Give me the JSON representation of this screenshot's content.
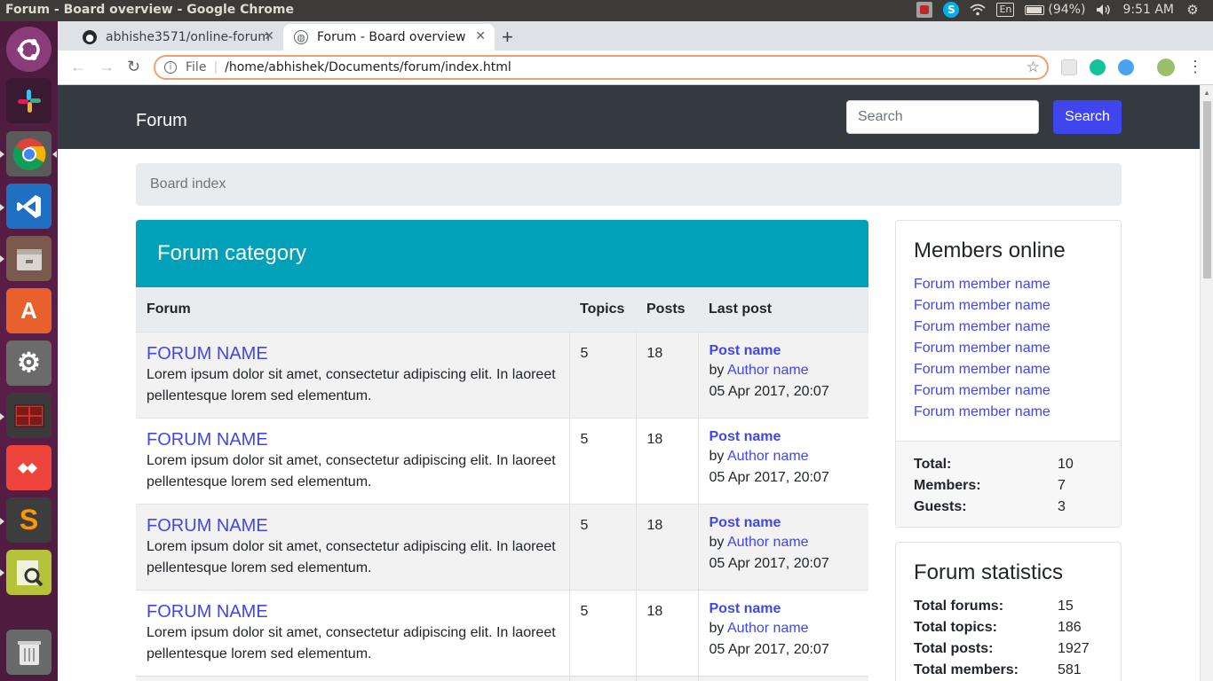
{
  "os": {
    "window_title": "Forum - Board overview - Google Chrome",
    "battery": "(94%)",
    "keyboard_layout": "En",
    "clock": "9:51 AM"
  },
  "browser": {
    "tabs": [
      {
        "title": "abhishe3571/online-forum",
        "icon": "github-icon"
      },
      {
        "title": "Forum - Board overview",
        "icon": "globe-icon"
      }
    ],
    "address_scheme": "File",
    "address": "/home/abhishek/Documents/forum/index.html"
  },
  "page": {
    "brand": "Forum",
    "search": {
      "placeholder": "Search",
      "button": "Search"
    },
    "breadcrumb": "Board index",
    "category": {
      "title": "Forum category",
      "headers": [
        "Forum",
        "Topics",
        "Posts",
        "Last post"
      ],
      "rows": [
        {
          "name": "FORUM NAME",
          "desc": "Lorem ipsum dolor sit amet, consectetur adipiscing elit. In laoreet pellentesque lorem sed elementum.",
          "topics": "5",
          "posts": "18",
          "last_post": "Post name",
          "by": "by ",
          "author": "Author name",
          "date": "05 Apr 2017, 20:07"
        },
        {
          "name": "FORUM NAME",
          "desc": "Lorem ipsum dolor sit amet, consectetur adipiscing elit. In laoreet pellentesque lorem sed elementum.",
          "topics": "5",
          "posts": "18",
          "last_post": "Post name",
          "by": "by ",
          "author": "Author name",
          "date": "05 Apr 2017, 20:07"
        },
        {
          "name": "FORUM NAME",
          "desc": "Lorem ipsum dolor sit amet, consectetur adipiscing elit. In laoreet pellentesque lorem sed elementum.",
          "topics": "5",
          "posts": "18",
          "last_post": "Post name",
          "by": "by ",
          "author": "Author name",
          "date": "05 Apr 2017, 20:07"
        },
        {
          "name": "FORUM NAME",
          "desc": "Lorem ipsum dolor sit amet, consectetur adipiscing elit. In laoreet pellentesque lorem sed elementum.",
          "topics": "5",
          "posts": "18",
          "last_post": "Post name",
          "by": "by ",
          "author": "Author name",
          "date": "05 Apr 2017, 20:07"
        }
      ]
    },
    "members_online": {
      "title": "Members online",
      "members": [
        "Forum member name",
        "Forum member name",
        "Forum member name",
        "Forum member name",
        "Forum member name",
        "Forum member name",
        "Forum member name"
      ],
      "totals": [
        {
          "label": "Total:",
          "value": "10"
        },
        {
          "label": "Members:",
          "value": "7"
        },
        {
          "label": "Guests:",
          "value": "3"
        }
      ]
    },
    "forum_statistics": {
      "title": "Forum statistics",
      "stats": [
        {
          "label": "Total forums:",
          "value": "15"
        },
        {
          "label": "Total topics:",
          "value": "186"
        },
        {
          "label": "Total posts:",
          "value": "1927"
        },
        {
          "label": "Total members:",
          "value": "581"
        }
      ]
    }
  },
  "colors": {
    "navbar": "#343a40",
    "accent_button": "#4046ee",
    "category_header": "#00a1b9",
    "link": "#4046ee"
  }
}
